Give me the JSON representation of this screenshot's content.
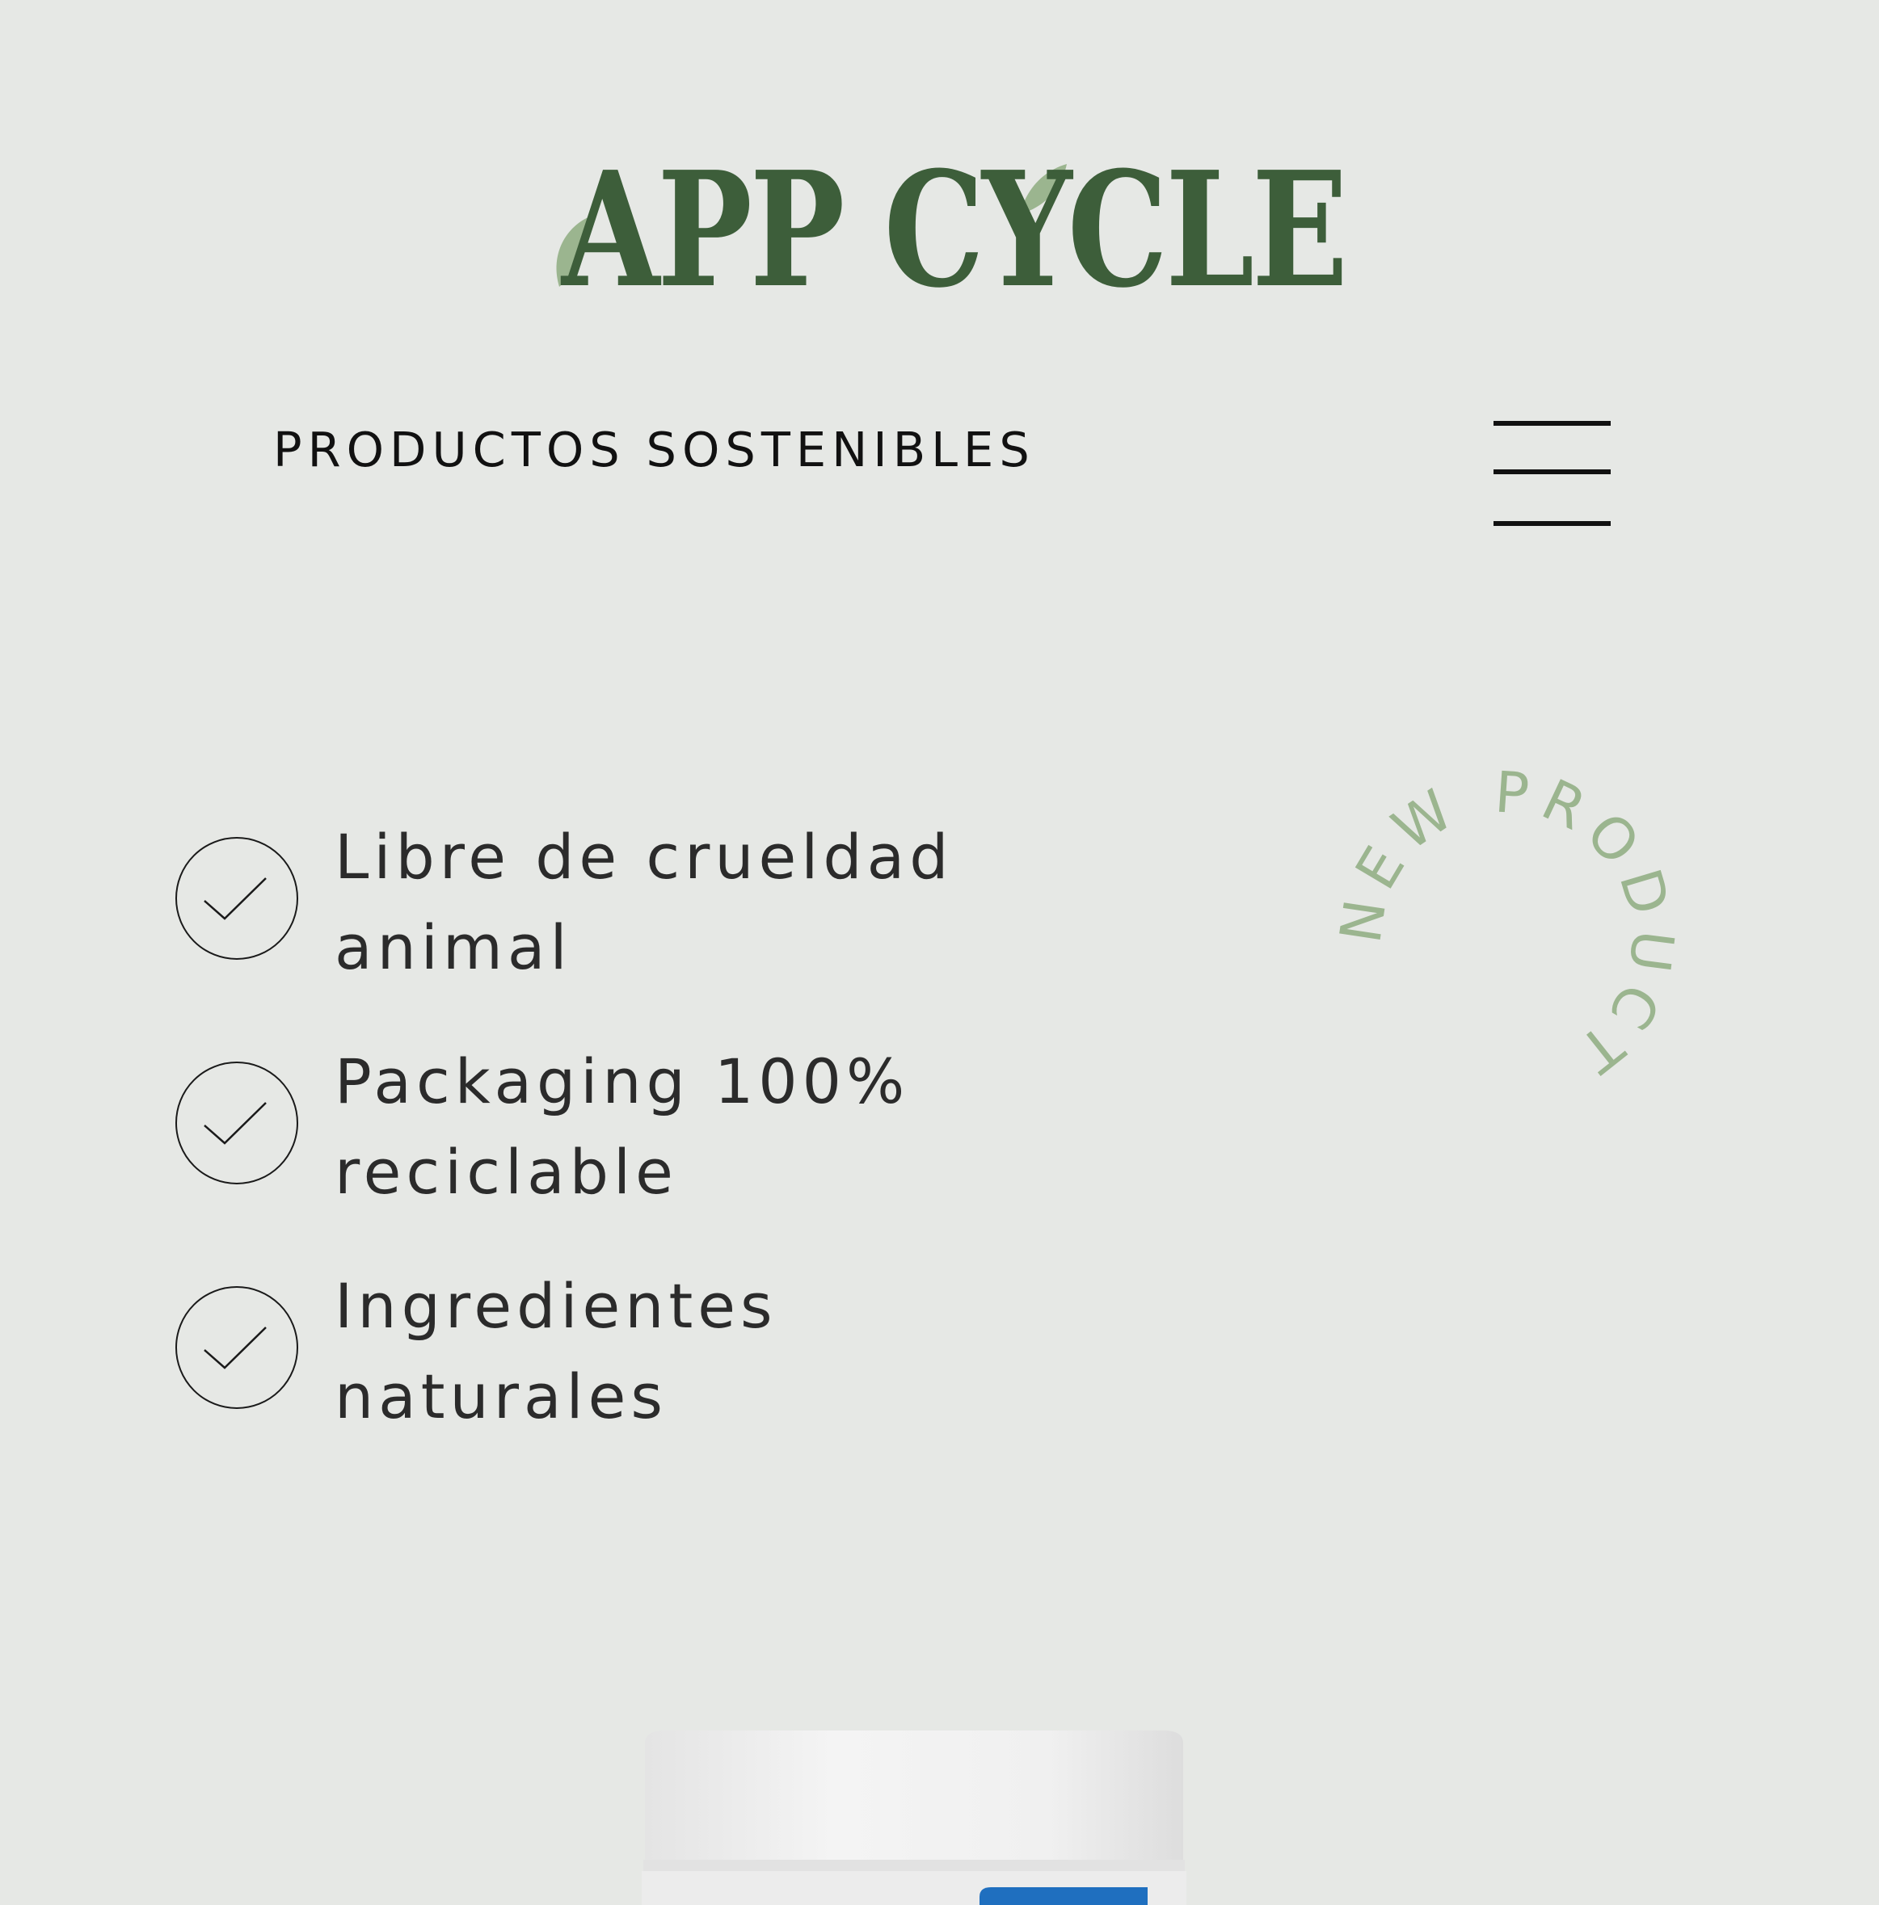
{
  "brand": {
    "name": "APP CYCLE",
    "color": "#3d5e3a",
    "leaf_color": "#9bb58f"
  },
  "header": {
    "tagline": "PRODUCTOS SOSTENIBLES",
    "menu_icon": "hamburger-menu-icon"
  },
  "features": [
    {
      "icon": "check-circle-icon",
      "line1": "Libre de crueldad",
      "line2": "animal"
    },
    {
      "icon": "check-circle-icon",
      "line1": "Packaging 100%",
      "line2": "reciclable"
    },
    {
      "icon": "check-circle-icon",
      "line1": "Ingredientes",
      "line2": "naturales"
    }
  ],
  "badge": {
    "text": "NEW PRODUCT",
    "color": "#9bb58f"
  },
  "product": {
    "image": "product-jar-image",
    "label_color": "#1f6fbf"
  }
}
